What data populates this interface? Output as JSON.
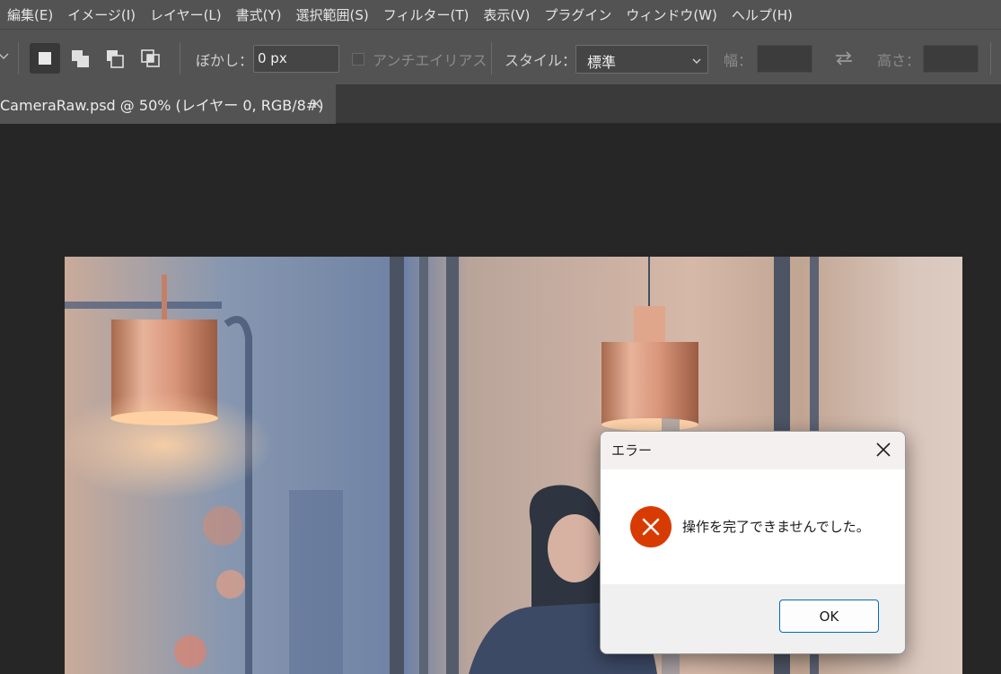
{
  "menubar": {
    "items": [
      "編集(E)",
      "イメージ(I)",
      "レイヤー(L)",
      "書式(Y)",
      "選択範囲(S)",
      "フィルター(T)",
      "表示(V)",
      "プラグイン",
      "ウィンドウ(W)",
      "ヘルプ(H)"
    ]
  },
  "options": {
    "feather_label": "ぼかし：",
    "feather_value": "0 px",
    "antialias_label": "アンチエイリアス",
    "style_label": "スタイル：",
    "style_value": "標準",
    "width_label": "幅：",
    "height_label": "高さ：",
    "icons": [
      "new-selection-icon",
      "add-selection-icon",
      "subtract-selection-icon",
      "intersect-selection-icon",
      "swap-icon",
      "chevron-down-icon"
    ]
  },
  "document": {
    "tab_title": "CameraRaw.psd @ 50% (レイヤー 0, RGB/8#)",
    "close_glyph": "×"
  },
  "dialog": {
    "title": "エラー",
    "message": "操作を完了できませんでした。",
    "ok_label": "OK",
    "error_color": "#d83b01"
  }
}
